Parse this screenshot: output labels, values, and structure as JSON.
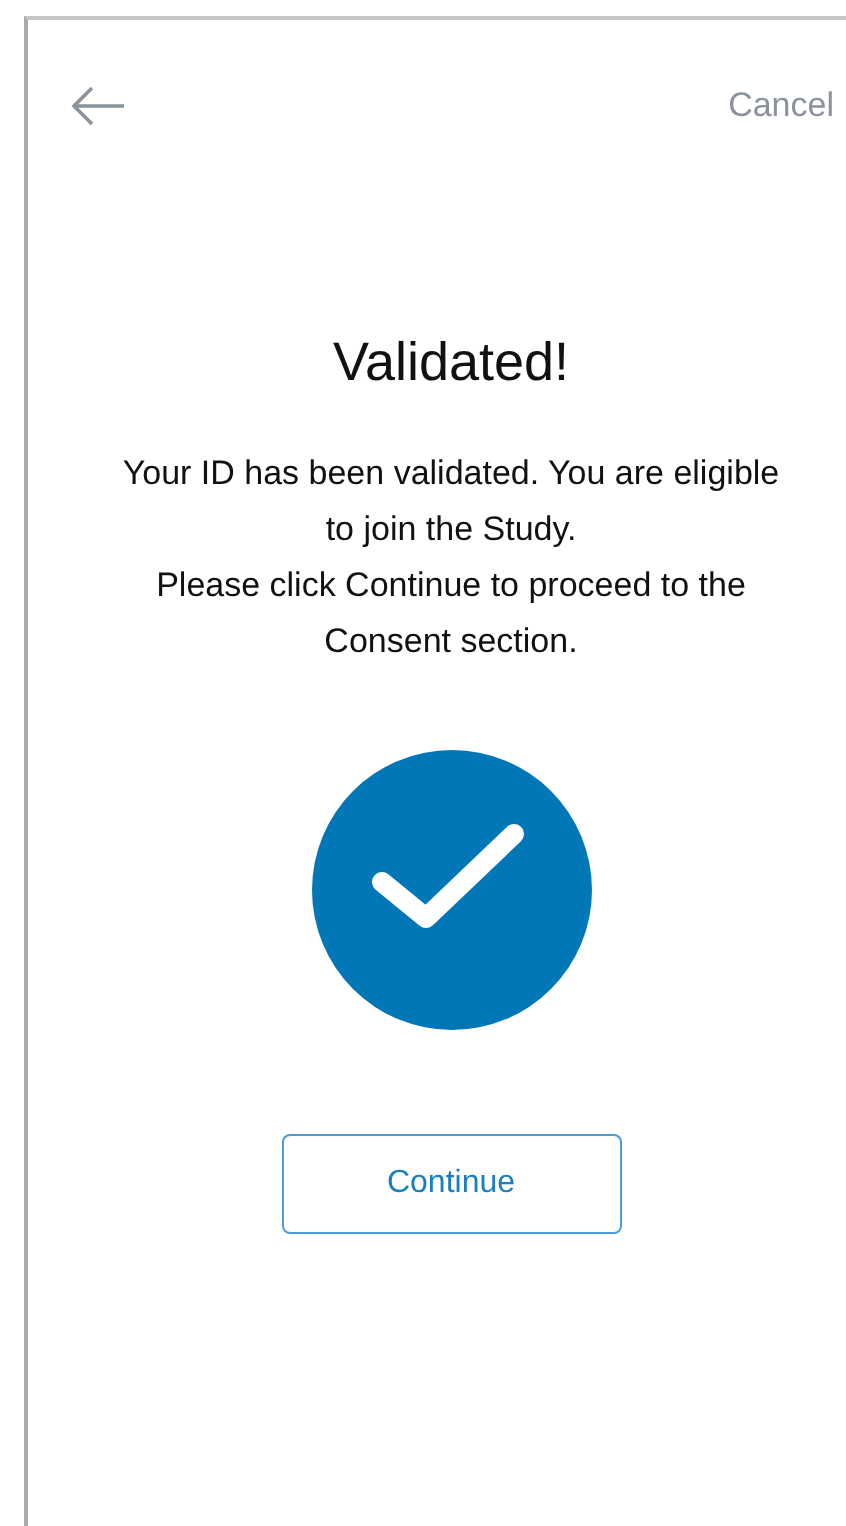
{
  "header": {
    "cancel": "Cancel"
  },
  "title": "Validated!",
  "messages": [
    "Your ID has been validated. You are eligible to join the Study.",
    "Please click Continue to proceed to the Consent section."
  ],
  "status": {
    "kind": "success"
  },
  "button": "Continue"
}
